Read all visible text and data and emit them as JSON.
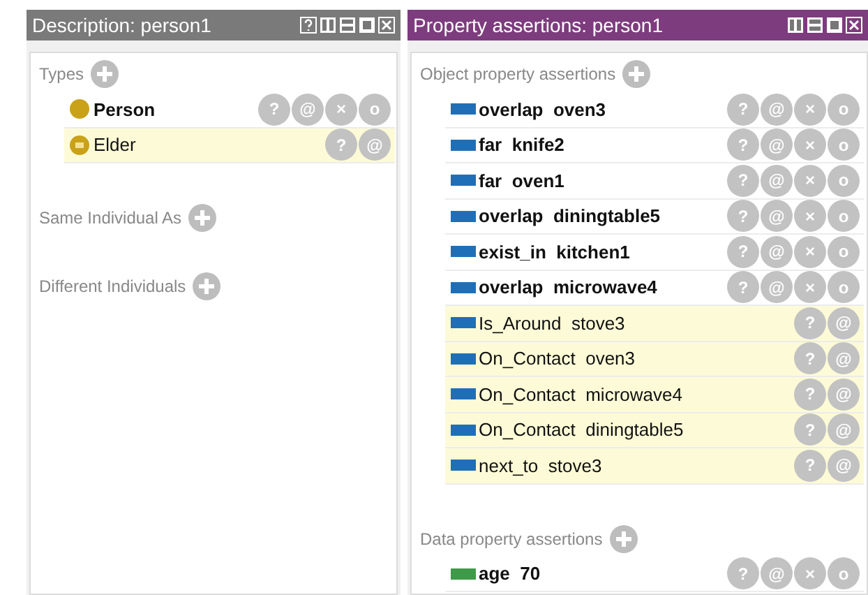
{
  "description_panel": {
    "title": "Description: person1",
    "sections": [
      {
        "label": "Types",
        "items": [
          {
            "name": "Person",
            "kind": "asserted",
            "buttons": [
              "?",
              "@",
              "×",
              "o"
            ]
          },
          {
            "name": "Elder",
            "kind": "inferred",
            "buttons": [
              "?",
              "@"
            ]
          }
        ]
      },
      {
        "label": "Same Individual As"
      },
      {
        "label": "Different Individuals"
      }
    ]
  },
  "property_panel": {
    "title": "Property assertions: person1",
    "sections": [
      {
        "label": "Object property assertions",
        "items": [
          {
            "name": "overlap  oven3",
            "kind": "asserted",
            "color": "#1f6fb8",
            "buttons": [
              "?",
              "@",
              "×",
              "o"
            ]
          },
          {
            "name": "far  knife2",
            "kind": "asserted",
            "color": "#1f6fb8",
            "buttons": [
              "?",
              "@",
              "×",
              "o"
            ]
          },
          {
            "name": "far  oven1",
            "kind": "asserted",
            "color": "#1f6fb8",
            "buttons": [
              "?",
              "@",
              "×",
              "o"
            ]
          },
          {
            "name": "overlap  diningtable5",
            "kind": "asserted",
            "color": "#1f6fb8",
            "buttons": [
              "?",
              "@",
              "×",
              "o"
            ]
          },
          {
            "name": "exist_in  kitchen1",
            "kind": "asserted",
            "color": "#1f6fb8",
            "buttons": [
              "?",
              "@",
              "×",
              "o"
            ]
          },
          {
            "name": "overlap  microwave4",
            "kind": "asserted",
            "color": "#1f6fb8",
            "buttons": [
              "?",
              "@",
              "×",
              "o"
            ]
          },
          {
            "name": "Is_Around  stove3",
            "kind": "inferred",
            "color": "#1f6fb8",
            "buttons": [
              "?",
              "@"
            ]
          },
          {
            "name": "On_Contact  oven3",
            "kind": "inferred",
            "color": "#1f6fb8",
            "buttons": [
              "?",
              "@"
            ]
          },
          {
            "name": "On_Contact  microwave4",
            "kind": "inferred",
            "color": "#1f6fb8",
            "buttons": [
              "?",
              "@"
            ]
          },
          {
            "name": "On_Contact  diningtable5",
            "kind": "inferred",
            "color": "#1f6fb8",
            "buttons": [
              "?",
              "@"
            ]
          },
          {
            "name": "next_to  stove3",
            "kind": "inferred",
            "color": "#1f6fb8",
            "buttons": [
              "?",
              "@"
            ]
          }
        ]
      },
      {
        "label": "Data property assertions",
        "items": [
          {
            "name": "age  70",
            "kind": "asserted",
            "color": "#3e9a48",
            "buttons": [
              "?",
              "@",
              "×",
              "o"
            ]
          }
        ]
      }
    ]
  }
}
